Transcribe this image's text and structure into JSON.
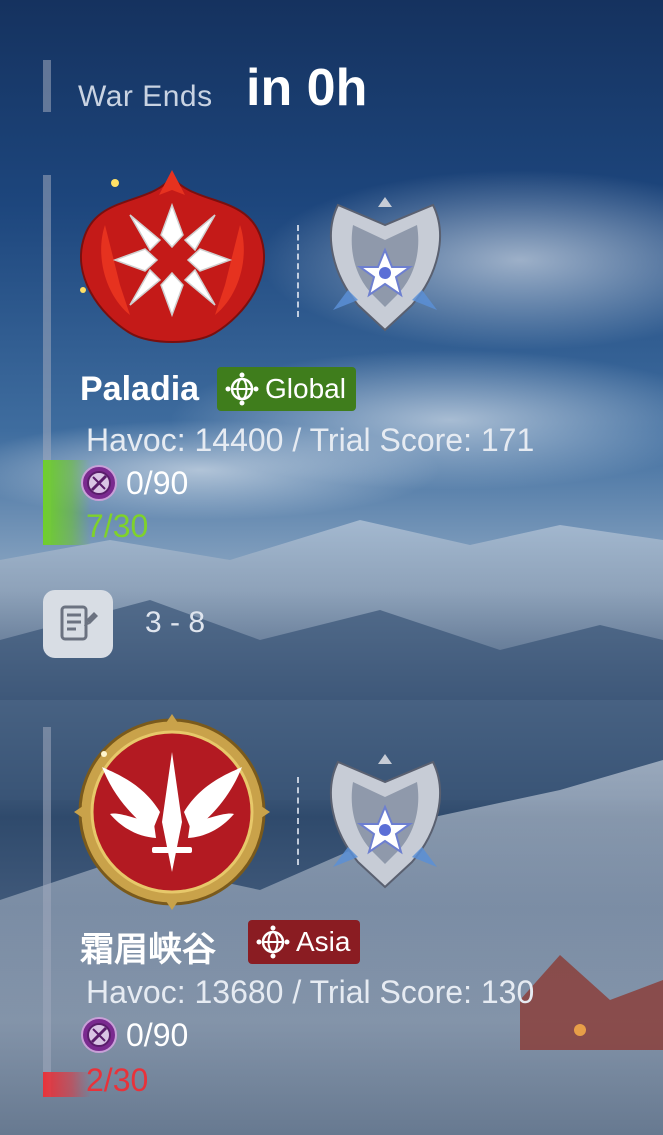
{
  "war": {
    "label": "War Ends",
    "time": "in 0h"
  },
  "guilds": [
    {
      "name": "Paladia",
      "region": "Global",
      "region_color": "#3f7d1c",
      "stats": "Havoc: 14400 / Trial Score: 171",
      "tokens": "0/90",
      "progress": "7/30",
      "progress_value": 0.2333,
      "progress_color": "#7fd22a",
      "emblem_icon": "flame-cross-emblem-icon",
      "rank_icon": "silver-wing-rank-icon"
    },
    {
      "name": "霜眉峡谷",
      "region": "Asia",
      "region_color": "#8a1c22",
      "stats": "Havoc: 13680 / Trial Score: 130",
      "tokens": "0/90",
      "progress": "2/30",
      "progress_value": 0.0667,
      "progress_color": "#e8323a",
      "emblem_icon": "winged-sword-emblem-icon",
      "rank_icon": "silver-wing-rank-icon"
    }
  ],
  "record": {
    "text": "3 - 8",
    "icon": "battle-log-icon"
  }
}
